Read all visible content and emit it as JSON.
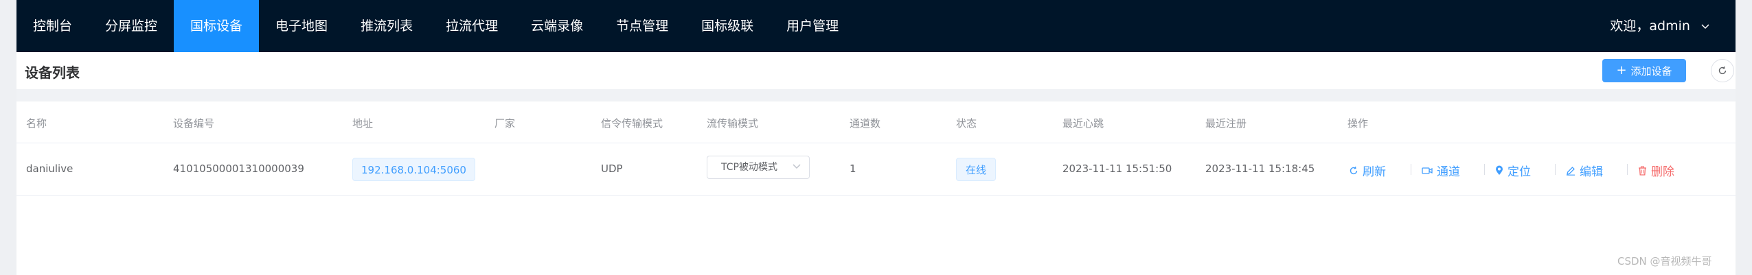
{
  "nav": {
    "items": [
      {
        "label": "控制台"
      },
      {
        "label": "分屏监控"
      },
      {
        "label": "国标设备"
      },
      {
        "label": "电子地图"
      },
      {
        "label": "推流列表"
      },
      {
        "label": "拉流代理"
      },
      {
        "label": "云端录像"
      },
      {
        "label": "节点管理"
      },
      {
        "label": "国标级联"
      },
      {
        "label": "用户管理"
      }
    ],
    "active_index": 2,
    "user_label": "欢迎，admin"
  },
  "panel": {
    "title": "设备列表",
    "add_button": "添加设备"
  },
  "table": {
    "headers": [
      "名称",
      "设备编号",
      "地址",
      "厂家",
      "信令传输模式",
      "流传输模式",
      "通道数",
      "状态",
      "最近心跳",
      "最近注册",
      "操作"
    ],
    "rows": [
      {
        "name": "daniulive",
        "device_id": "41010500001310000039",
        "address": "192.168.0.104:5060",
        "manufacturer": "",
        "signal_mode": "UDP",
        "stream_mode": "TCP被动模式",
        "channels": "1",
        "status": "在线",
        "last_heartbeat": "2023-11-11 15:51:50",
        "last_register": "2023-11-11 15:18:45"
      }
    ],
    "actions": {
      "refresh": "刷新",
      "channel": "通道",
      "locate": "定位",
      "edit": "编辑",
      "delete": "删除"
    }
  },
  "colors": {
    "nav_bg": "#001529",
    "nav_active": "#1890ff",
    "primary": "#409eff",
    "danger": "#f56c6c"
  },
  "watermark": "CSDN @音视频牛哥"
}
